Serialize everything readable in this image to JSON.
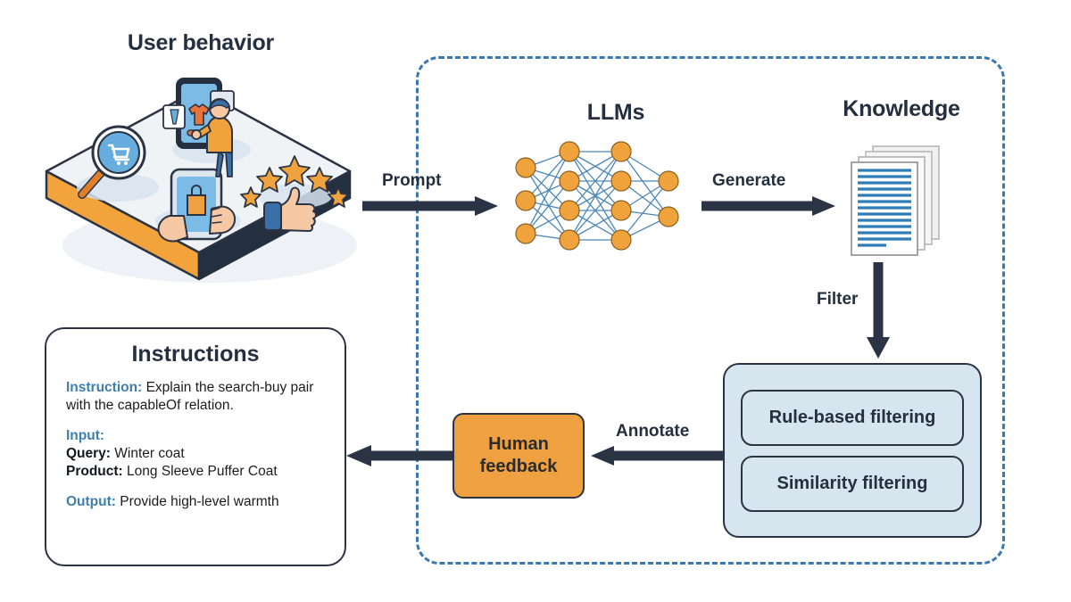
{
  "diagram": {
    "title_user_behavior": "User behavior",
    "title_llms": "LLMs",
    "title_knowledge": "Knowledge"
  },
  "arrows": {
    "prompt": "Prompt",
    "generate": "Generate",
    "filter": "Filter",
    "annotate": "Annotate"
  },
  "human_feedback": {
    "line1": "Human",
    "line2": "feedback"
  },
  "filtering": {
    "rule_based": "Rule-based filtering",
    "similarity": "Similarity filtering"
  },
  "instructions": {
    "heading": "Instructions",
    "instruction_key": "Instruction:",
    "instruction_value": "Explain the search-buy pair with the capableOf relation.",
    "input_key": "Input:",
    "query_key": "Query:",
    "query_value": "Winter coat",
    "product_key": "Product:",
    "product_value": "Long Sleeve Puffer Coat",
    "output_key": "Output:",
    "output_value": "Provide high-level warmth"
  },
  "colors": {
    "dark_navy": "#2b3445",
    "orange": "#efa040",
    "accent_blue": "#3b78ad",
    "light_blue_fill": "#d6e5ee",
    "node_orange": "#f0a33c",
    "edge_blue": "#4a87b8"
  },
  "illustration": {
    "platform_label": "isometric-platform",
    "icons": [
      "magnifier-cart-icon",
      "phone-shopping-bag-icon",
      "person-browsing-phone-icon",
      "five-stars-icon",
      "thumbs-up-icon"
    ],
    "star_count": 5
  },
  "neural_network": {
    "layer_sizes": [
      3,
      4,
      4,
      2
    ]
  },
  "knowledge_docs": {
    "sheet_count": 4,
    "text_line_count": 14
  }
}
